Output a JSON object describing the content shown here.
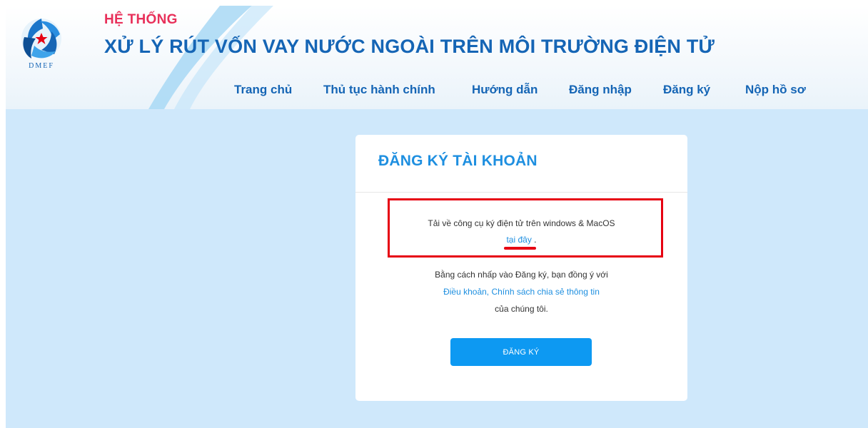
{
  "header": {
    "system_label": "HỆ THỐNG",
    "system_title": "XỬ LÝ RÚT VỐN VAY NƯỚC NGOÀI TRÊN MÔI TRƯỜNG ĐIỆN TỬ",
    "logo_text": "DMEF"
  },
  "nav": {
    "items": [
      {
        "label": "Trang chủ"
      },
      {
        "label": "Thủ tục hành chính"
      },
      {
        "label": "Hướng dẫn"
      },
      {
        "label": "Đăng nhập"
      },
      {
        "label": "Đăng ký"
      },
      {
        "label": "Nộp hồ sơ"
      }
    ]
  },
  "card": {
    "title": "ĐĂNG KÝ TÀI KHOẢN",
    "download_text": "Tải về công cụ ký điện tử trên windows & MacOS",
    "download_link": "tại đây",
    "download_suffix": ".",
    "terms_prefix": "Bằng cách nhấp vào Đăng ký, bạn đồng ý với",
    "terms_link": "Điều khoản, Chính sách chia sẻ thông tin",
    "terms_suffix": "của chúng tôi.",
    "register_button": "ĐĂNG KÝ"
  },
  "colors": {
    "accent": "#1e8fe0",
    "nav_text": "#1565b5",
    "system_label": "#e8305a",
    "highlight": "#e60012",
    "page_background": "#cfe8fb"
  }
}
